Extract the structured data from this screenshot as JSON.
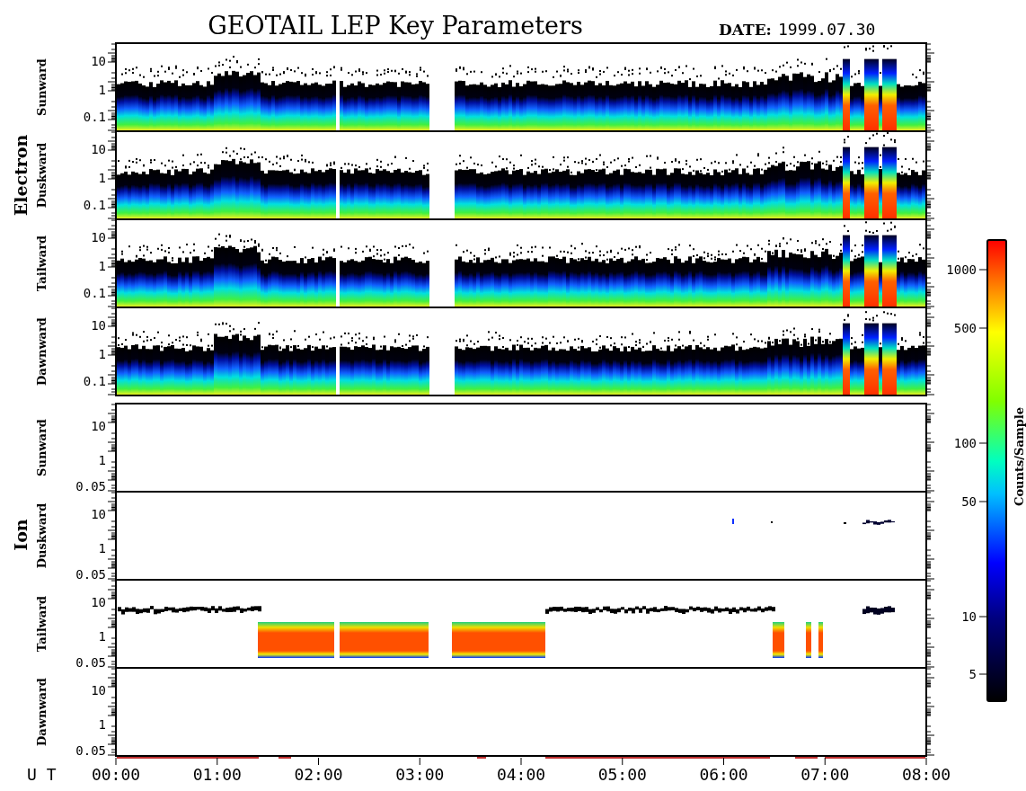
{
  "title": "GEOTAIL LEP Key Parameters",
  "date_label": "DATE:",
  "date": "1999.07.30",
  "groups": [
    {
      "label": "Electron",
      "kind": "electron",
      "panels": [
        {
          "label": "Sunward",
          "yticks": [
            "10",
            "1",
            "0.1"
          ]
        },
        {
          "label": "Duskward",
          "yticks": [
            "10",
            "1",
            "0.1"
          ]
        },
        {
          "label": "Tailward",
          "yticks": [
            "10",
            "1",
            "0.1"
          ]
        },
        {
          "label": "Dawnward",
          "yticks": [
            "10",
            "1",
            "0.1"
          ]
        }
      ]
    },
    {
      "label": "Ion",
      "kind": "ion",
      "panels": [
        {
          "label": "Sunward",
          "yticks": [
            "10",
            "1",
            "0.05"
          ]
        },
        {
          "label": "Duskward",
          "yticks": [
            "10",
            "1",
            "0.05"
          ]
        },
        {
          "label": "Tailward",
          "yticks": [
            "10",
            "1",
            "0.05"
          ]
        },
        {
          "label": "Dawnward",
          "yticks": [
            "10",
            "1",
            "0.05"
          ]
        }
      ]
    }
  ],
  "time_axis": {
    "label": "U T",
    "ticks": [
      "00:00",
      "01:00",
      "02:00",
      "03:00",
      "04:00",
      "05:00",
      "06:00",
      "07:00",
      "08:00"
    ]
  },
  "color_scale": {
    "label": "Counts/Sample",
    "ticks": [
      "1000",
      "500",
      "100",
      "50",
      "10",
      "5"
    ]
  }
}
